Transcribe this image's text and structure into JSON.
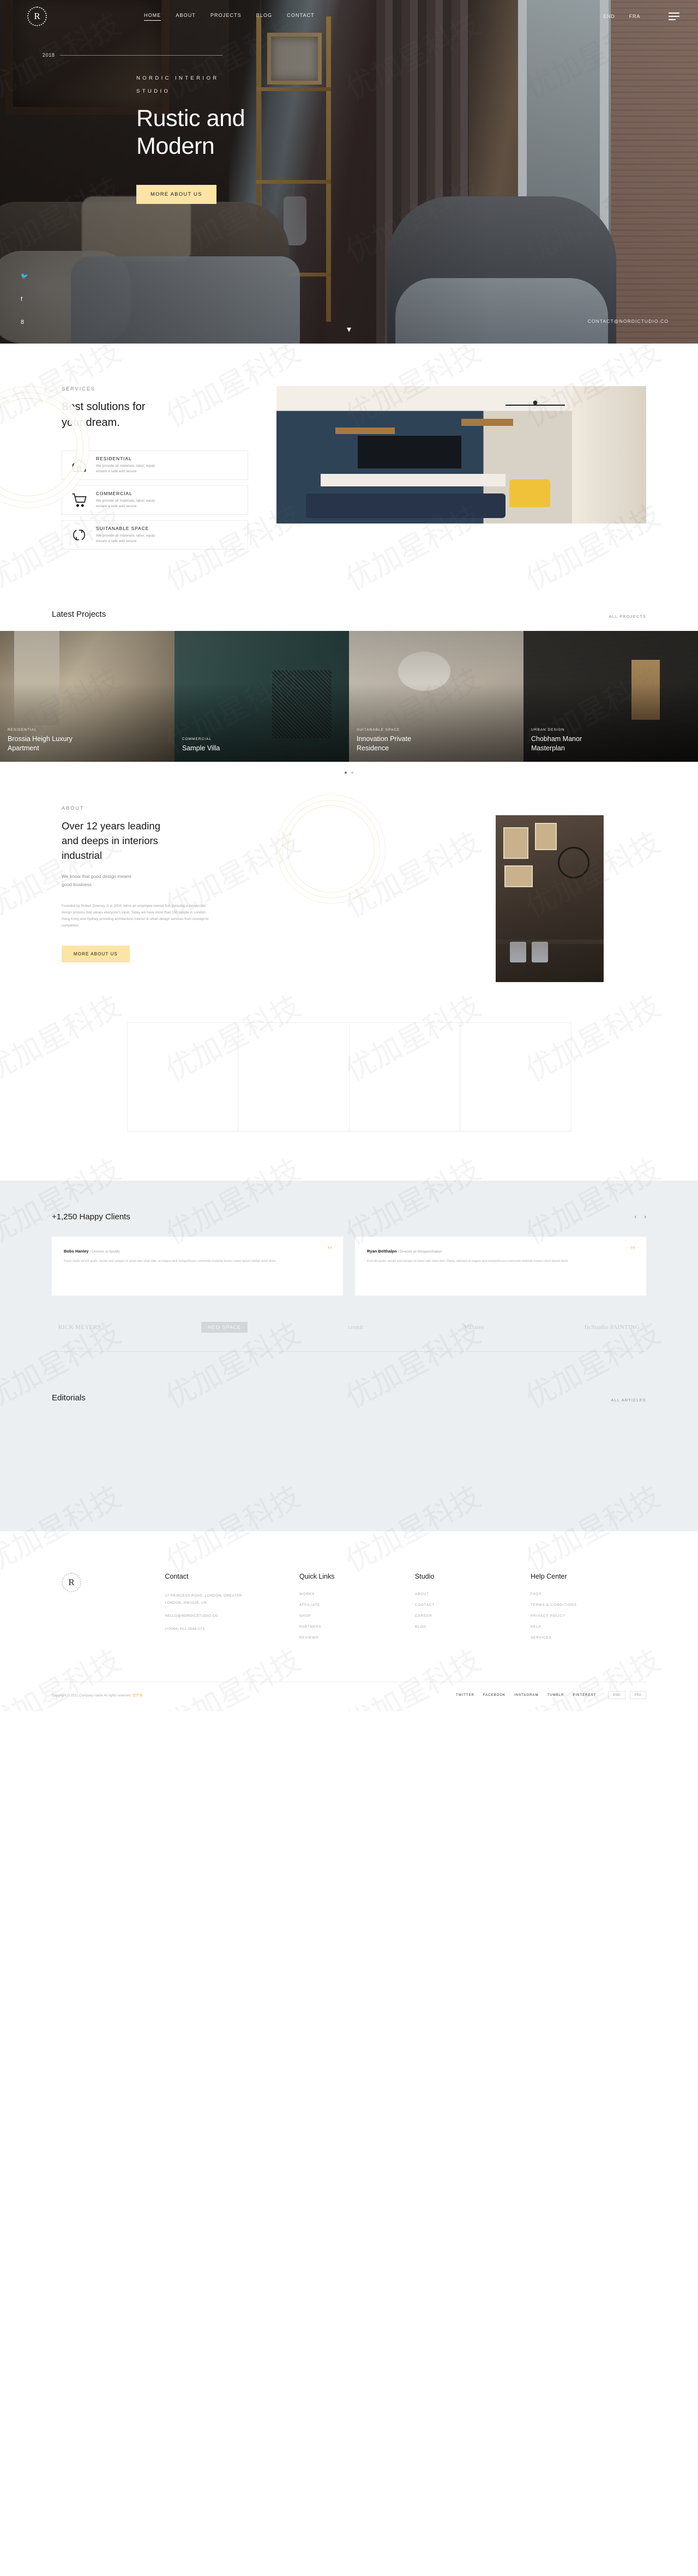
{
  "header": {
    "logo_letter": "R",
    "nav": [
      {
        "label": "HOME",
        "active": true
      },
      {
        "label": "ABOUT",
        "active": false
      },
      {
        "label": "PROJECTS",
        "active": false
      },
      {
        "label": "BLOG",
        "active": false
      },
      {
        "label": "CONTACT",
        "active": false
      }
    ],
    "languages": [
      "END",
      "FRA"
    ]
  },
  "hero": {
    "year": "2018",
    "eyebrow": "NORDIC INTERIOR STUDIO",
    "title_line1": "Rustic and",
    "title_line2": "Modern",
    "cta": "MORE ABOUT US",
    "email": "CONTACT@NORDICTUDIO.CO",
    "social": [
      "twitter-icon",
      "facebook-icon",
      "google-plus-icon"
    ]
  },
  "services": {
    "kicker": "SERVICES",
    "heading_line1": "Best solutions for",
    "heading_line2": "your dream.",
    "items": [
      {
        "icon": "home-icon",
        "title": "RESIDENTIAL",
        "desc_line1": "We provide all materials, labor, equip",
        "desc_line2": "ensure a safe and secure"
      },
      {
        "icon": "cart-icon",
        "title": "COMMERCIAL",
        "desc_line1": "We provide all materials, labor, equip",
        "desc_line2": "ensure a safe and secure"
      },
      {
        "icon": "refresh-icon",
        "title": "SUITANABLE SPACE",
        "desc_line1": "We provide all materials, labor, equip",
        "desc_line2": "ensure a safe and secure"
      }
    ]
  },
  "projects": {
    "heading": "Latest Projects",
    "all_link": "ALL PROJECTS",
    "items": [
      {
        "tag": "RESIDENTIAL",
        "name_line1": "Brossia Heigh Luxury",
        "name_line2": "Apartment"
      },
      {
        "tag": "COMMERCIAL",
        "name_line1": "Sample Villa",
        "name_line2": ""
      },
      {
        "tag": "SUITANABLE SPACE",
        "name_line1": "Innovation Private",
        "name_line2": "Residence"
      },
      {
        "tag": "URBAN DESIGN",
        "name_line1": "Chobham Manor",
        "name_line2": "Masterplan"
      }
    ]
  },
  "about": {
    "kicker": "ABOUT",
    "heading_line1": "Over 12 years leading",
    "heading_line2": "and deeps in interiors",
    "heading_line3": "industrial",
    "sub_line1": "We know that good design means",
    "sub_line2": "good business",
    "body": "Founded by Robert Downey Jr in 2004, we're an employee-owned firm pursuing a democratic design process that values everyone's input. Today we have more than 150 people in London, Hong Kong and Sydney providing architecture, interior & urban design services from concept to completion.",
    "cta": "MORE ABOUT US"
  },
  "clients": {
    "heading": "+1,250 Happy Clients",
    "prev": "‹",
    "next": "›",
    "testimonials": [
      {
        "name": "Bobs Hanley",
        "role": "/ Director at Spotify",
        "quote": "Paras stalor ed elit quam, iaculis sed semper sit amet udin vitae nibh. at magna akal semperFusce commodo molestie luctus Lorem ipsum vitalup tortor dolor."
      },
      {
        "name": "Ryan Belthalpn",
        "role": "/ Director at Shopperchakes",
        "quote": "Erat elit quam, iaculis sed semper sit amet udin vitae nibh. Rutrio, element at magna akal semperFusce commodo molestie luctus Lorem ipsum dolor."
      }
    ],
    "brands": [
      "RICK MEYERS",
      "NEO SPACE",
      "cronit",
      "Villates",
      "ficStudio PAINTING"
    ]
  },
  "editorials": {
    "heading": "Editorials",
    "all_link": "ALL ARTICLES"
  },
  "footer": {
    "logo_letter": "R",
    "columns": [
      {
        "title": "Contact",
        "lines": [
          "17 PRINCESS ROAD, LONDON, GREATER",
          "LONDON, NW18JR, UK",
          "HELLO@NORDICSTUDIO.CO",
          "(+0084) 912-3548-073"
        ]
      },
      {
        "title": "Quick Links",
        "links": [
          "WORKS",
          "AFFILIATE",
          "SHOP",
          "PARTNERS",
          "REVIEWS"
        ]
      },
      {
        "title": "Studio",
        "links": [
          "ABOUT",
          "CONTACT",
          "CAREER",
          "BLOG"
        ]
      },
      {
        "title": "Help Center",
        "links": [
          "FAQS",
          "TERMS & CONDITIONS",
          "PRIVACY POLICY",
          "HELP",
          "SERVICES"
        ]
      }
    ],
    "copyright": "Copyright © 2021.Company name All rights reserved.",
    "copyright_accent": "医疗美",
    "social": [
      "TWITTER",
      "FACEBOOK",
      "INSTAGRAM",
      "TUMBLR",
      "PINTEREST"
    ],
    "lang_pills": [
      "ENG",
      "FRA"
    ]
  },
  "watermark": "优加星科技"
}
